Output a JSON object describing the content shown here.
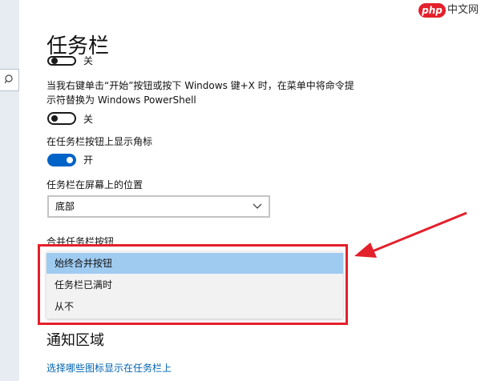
{
  "page": {
    "title": "任务栏"
  },
  "settings": {
    "top_toggle_label": "关",
    "powershell_text": "当我右键单击“开始”按钮或按下 Windows 键+X 时，在菜单中将命令提示符替换为 Windows PowerShell",
    "powershell_line1": "当我右键单击“开始”按钮或按下 Windows 键+X 时，在菜单中将命令提",
    "powershell_line2": "示符替换为 Windows PowerShell",
    "powershell_toggle_label": "关",
    "badges_text": "在任务栏按钮上显示角标",
    "badges_toggle_label": "开",
    "position_label": "任务栏在屏幕上的位置",
    "position_value": "底部",
    "combine_label": "合并任务栏按钮",
    "combine_options": [
      "始终合并按钮",
      "任务栏已满时",
      "从不"
    ],
    "combine_selected_index": 0
  },
  "notification": {
    "section_title": "通知区域",
    "link": "选择哪些图标显示在任务栏上"
  },
  "watermark": {
    "php": "php",
    "site": "中文网"
  },
  "colors": {
    "accent": "#0063c8",
    "selected_option": "#9fcbf1",
    "annotation_red": "#e3202b",
    "link": "#0063b1"
  }
}
